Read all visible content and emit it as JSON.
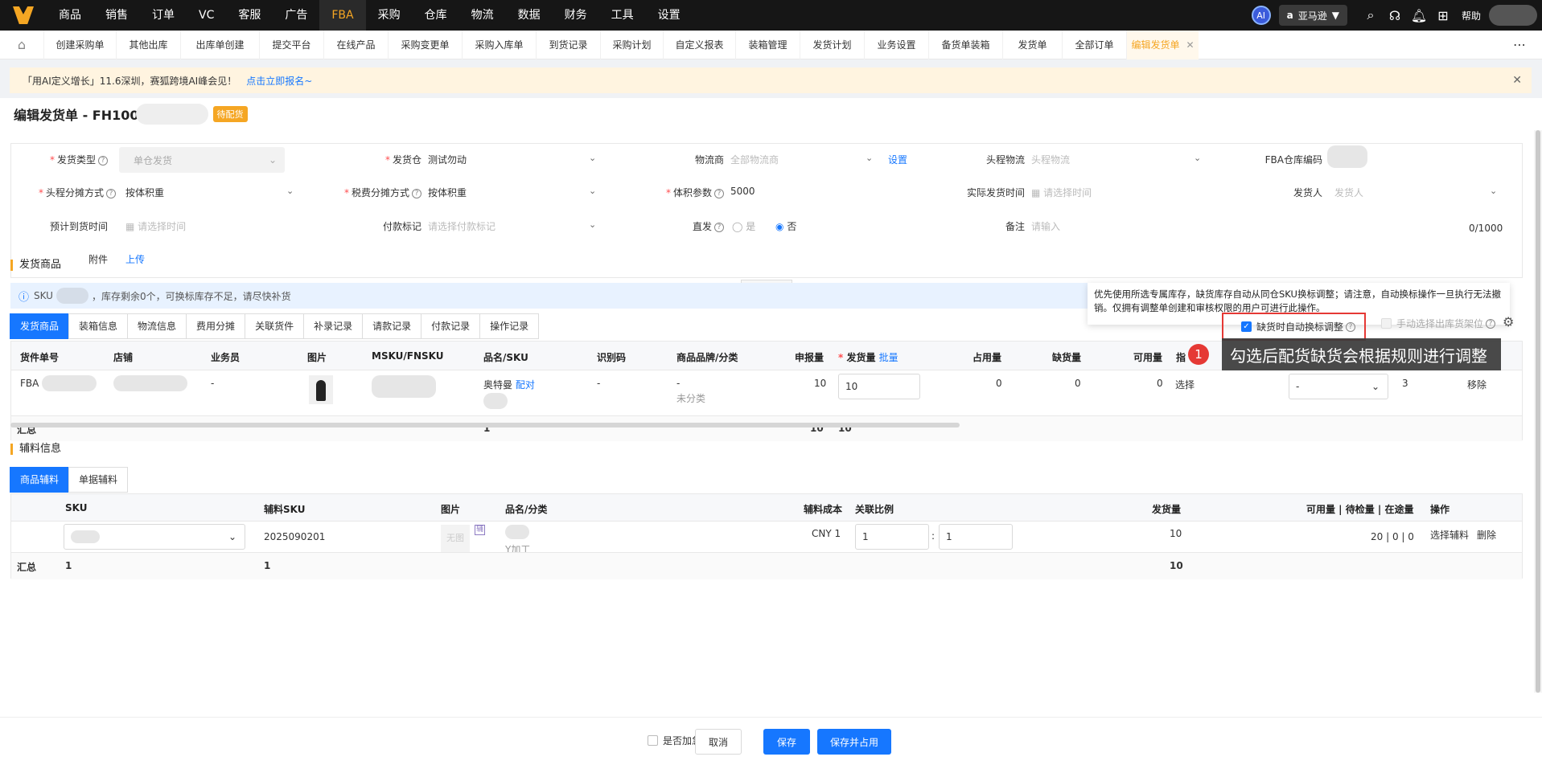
{
  "topnav": {
    "items": [
      "商品",
      "销售",
      "订单",
      "VC",
      "客服",
      "广告",
      "FBA",
      "采购",
      "仓库",
      "物流",
      "数据",
      "财务",
      "工具",
      "设置"
    ],
    "active_index": 6,
    "ai_label": "AI",
    "marketplace": "亚马逊",
    "help": "帮助"
  },
  "tabs": {
    "items": [
      "创建采购单",
      "其他出库",
      "出库单创建",
      "提交平台",
      "在线产品",
      "采购变更单",
      "采购入库单",
      "到货记录",
      "采购计划",
      "自定义报表",
      "装箱管理",
      "发货计划",
      "业务设置",
      "备货单装箱",
      "发货单",
      "全部订单",
      "编辑发货单"
    ],
    "active_index": 16
  },
  "notice": {
    "text": "「用AI定义增长」11.6深圳，赛狐跨境AI峰会见！",
    "link": "点击立即报名~"
  },
  "page": {
    "title": "编辑发货单 - FH100",
    "status_badge": "待配货"
  },
  "form": {
    "ship_type_label": "发货类型",
    "ship_type_value": "单仓发货",
    "warehouse_label": "发货仓",
    "warehouse_value": "测试勿动",
    "carrier_label": "物流商",
    "carrier_placeholder": "全部物流商",
    "settings_link": "设置",
    "head_logistics_label": "头程物流",
    "head_logistics_placeholder": "头程物流",
    "fba_code_label": "FBA仓库编码",
    "head_alloc_label": "头程分摊方式",
    "head_alloc_value": "按体积重",
    "tax_alloc_label": "税费分摊方式",
    "tax_alloc_value": "按体积重",
    "volume_label": "体积参数",
    "volume_value": "5000",
    "actual_ship_label": "实际发货时间",
    "actual_ship_placeholder": "请选择时间",
    "shipper_label": "发货人",
    "shipper_placeholder": "发货人",
    "eta_label": "预计到货时间",
    "eta_placeholder": "请选择时间",
    "payment_mark_label": "付款标记",
    "payment_mark_placeholder": "请选择付款标记",
    "direct_label": "直发",
    "direct_yes": "是",
    "direct_no": "否",
    "remark_label": "备注",
    "remark_placeholder": "请输入",
    "remark_count": "0/1000",
    "attach_label": "附件",
    "upload_link": "上传",
    "collapse": "收起"
  },
  "goods_section": {
    "title": "发货商品",
    "info_prefix": "SKU",
    "info_text": "，库存剩余0个，可换标库存不足，请尽快补货",
    "tooltip": "优先使用所选专属库存，缺货库存自动从同仓SKU换标调整；请注意，自动换标操作一旦执行无法撤销。仅拥有调整单创建和审核权限的用户可进行此操作。",
    "subtabs": [
      "发货商品",
      "装箱信息",
      "物流信息",
      "费用分摊",
      "关联货件",
      "补录记录",
      "请款记录",
      "付款记录",
      "操作记录"
    ],
    "auto_check_label": "缺货时自动换标调整",
    "auto_check_checked": true,
    "manual_check_label": "手动选择出库货架位",
    "annotation_num": "1",
    "annotation_text": "勾选后配货缺货会根据规则进行调整",
    "columns": [
      "货件单号",
      "店铺",
      "业务员",
      "图片",
      "MSKU/FNSKU",
      "品名/SKU",
      "识别码",
      "商品品牌/分类",
      "申报量",
      "发货量",
      "批量",
      "占用量",
      "缺货量",
      "可用量",
      "指"
    ],
    "row": {
      "shipment": "FBA",
      "salesman": "-",
      "product_name": "奥特曼",
      "pair_link": "配对",
      "ident": "-",
      "brand": "-",
      "category": "未分类",
      "declared": "10",
      "ship_qty": "10",
      "occupied": "0",
      "shortage": "0",
      "available": "0",
      "select_link": "选择",
      "dropdown": "-",
      "extra": "3",
      "remove_link": "移除"
    },
    "summary": {
      "label": "汇总",
      "sku_count": "1",
      "declared": "10",
      "ship_qty": "10"
    }
  },
  "aux_section": {
    "title": "辅料信息",
    "subtabs": [
      "商品辅料",
      "单据辅料"
    ],
    "columns": [
      "SKU",
      "辅料SKU",
      "图片",
      "品名/分类",
      "辅料成本",
      "关联比例",
      "发货量",
      "可用量 | 待检量 | 在途量",
      "操作"
    ],
    "row": {
      "aux_sku": "2025090201",
      "no_image": "无图",
      "category": "Y加工",
      "cost": "CNY 1",
      "ratio_a": "1",
      "ratio_b": "1",
      "ship_qty": "10",
      "stock": "20 | 0 | 0",
      "select_link": "选择辅料",
      "delete_link": "删除"
    },
    "summary": {
      "label": "汇总",
      "sku": "1",
      "aux_sku": "1",
      "ship_qty": "10"
    }
  },
  "footer": {
    "urgent_label": "是否加急",
    "cancel": "取消",
    "save": "保存",
    "save_occupy": "保存并占用"
  },
  "colors": {
    "brand": "#f5a623",
    "primary": "#1677ff",
    "danger": "#e53935"
  }
}
